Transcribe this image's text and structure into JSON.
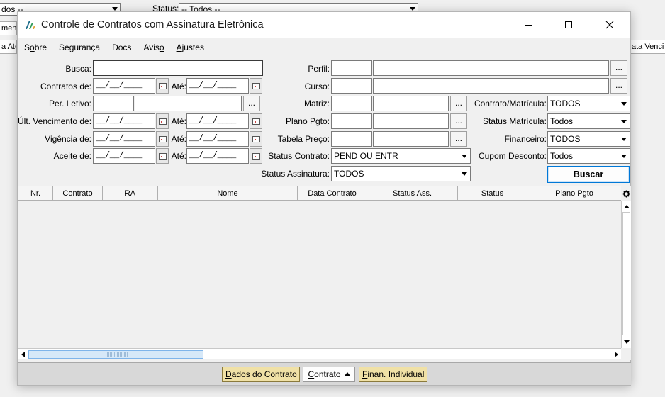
{
  "background": {
    "combo_left_value": "dos --",
    "status_label": "Status:",
    "status_value": "-- Todos --",
    "tab_left_1": "men",
    "tab_left_2": "a Ate",
    "tab_right": "ata Venci"
  },
  "window": {
    "title": "Controle de Contratos com Assinatura Eletrônica"
  },
  "menu": [
    {
      "pre": "S",
      "u": "o",
      "post": "bre"
    },
    {
      "pre": "Segurança",
      "u": "",
      "post": ""
    },
    {
      "pre": "Docs",
      "u": "",
      "post": ""
    },
    {
      "pre": "Avis",
      "u": "o",
      "post": ""
    },
    {
      "pre": "",
      "u": "A",
      "post": "justes"
    }
  ],
  "form": {
    "busca_label": "Busca:",
    "busca_value": "",
    "contratos_de_label": "Contratos de:",
    "ate_label": "Até:",
    "date_placeholder": "__/__/____",
    "per_letivo_label": "Per. Letivo:",
    "ult_vencimento_label": "Últ. Vencimento de:",
    "vigencia_label": "Vigência de:",
    "aceite_label": "Aceite de:",
    "perfil_label": "Perfil:",
    "curso_label": "Curso:",
    "matriz_label": "Matriz:",
    "plano_pgto_label": "Plano Pgto:",
    "tabela_preco_label": "Tabela Preço:",
    "status_contrato_label": "Status Contrato:",
    "status_contrato_value": "PEND OU ENTR",
    "status_assinatura_label": "Status Assinatura:",
    "status_assinatura_value": "TODOS",
    "contrato_matricula_label": "Contrato/Matrícula:",
    "contrato_matricula_value": "TODOS",
    "status_matricula_label": "Status Matrícula:",
    "status_matricula_value": "Todos",
    "financeiro_label": "Financeiro:",
    "financeiro_value": "TODOS",
    "cupom_desconto_label": "Cupom Desconto:",
    "cupom_desconto_value": "Todos",
    "ellipsis": "...",
    "buscar_label": "Buscar"
  },
  "grid": {
    "columns": [
      "Nr.",
      "Contrato",
      "RA",
      "Nome",
      "Data Contrato",
      "Status Ass.",
      "Status",
      "Plano Pgto"
    ]
  },
  "bottom": {
    "dados_contrato": {
      "pre": "",
      "u": "D",
      "post": "ados do Contrato"
    },
    "contrato": {
      "pre": "",
      "u": "C",
      "post": "ontrato"
    },
    "finan_individual": {
      "pre": "",
      "u": "F",
      "post": "inan. Individual"
    }
  }
}
